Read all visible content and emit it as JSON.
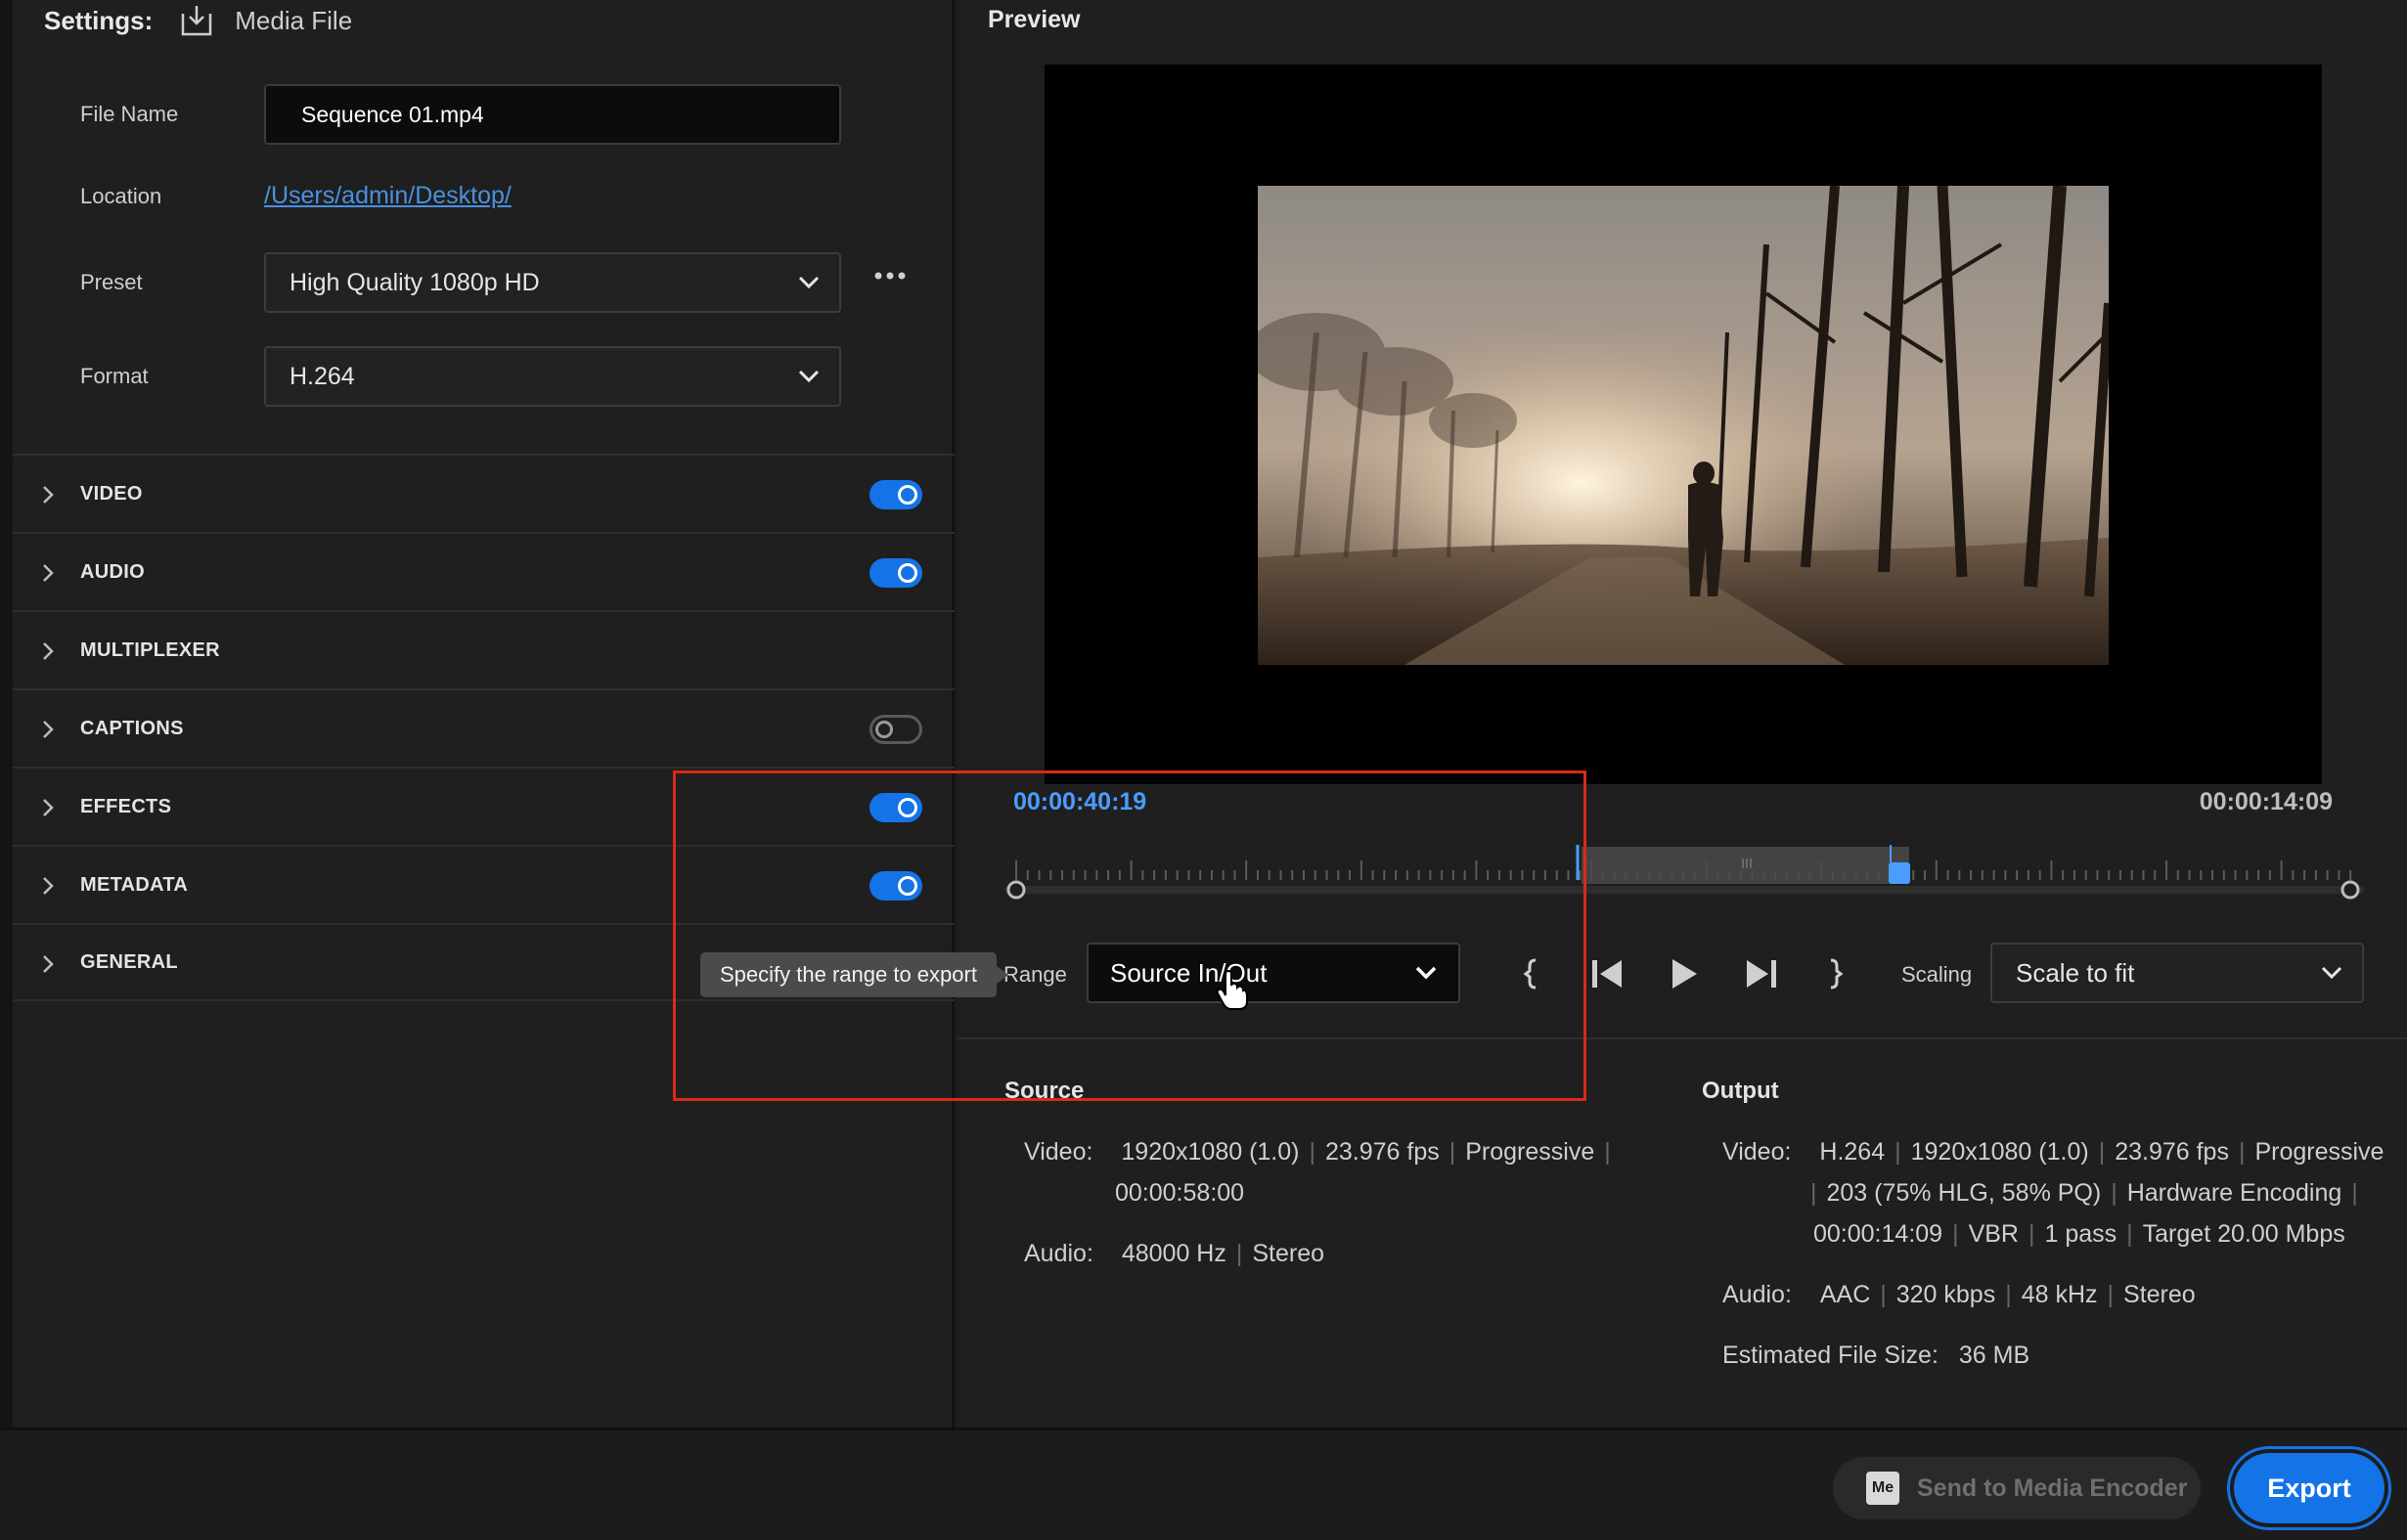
{
  "settings": {
    "title": "Settings:",
    "destination": "Media File",
    "file_name_label": "File Name",
    "file_name": "Sequence 01.mp4",
    "location_label": "Location",
    "location": "/Users/admin/Desktop/",
    "preset_label": "Preset",
    "preset": "High Quality 1080p HD",
    "format_label": "Format",
    "format": "H.264",
    "sections": [
      {
        "label": "VIDEO",
        "toggle": "on"
      },
      {
        "label": "AUDIO",
        "toggle": "on"
      },
      {
        "label": "MULTIPLEXER",
        "toggle": "none"
      },
      {
        "label": "CAPTIONS",
        "toggle": "off"
      },
      {
        "label": "EFFECTS",
        "toggle": "on"
      },
      {
        "label": "METADATA",
        "toggle": "on"
      },
      {
        "label": "GENERAL",
        "toggle": "none"
      }
    ]
  },
  "preview": {
    "title": "Preview",
    "current_time": "00:00:40:19",
    "duration": "00:00:14:09",
    "range_label": "Range",
    "range_value": "Source In/Out",
    "scaling_label": "Scaling",
    "scaling_value": "Scale to fit",
    "tooltip": "Specify the range to export"
  },
  "source": {
    "heading": "Source",
    "video_key": "Video:",
    "video_line1": [
      "1920x1080 (1.0)",
      "23.976 fps",
      "Progressive"
    ],
    "video_line2": "00:00:58:00",
    "audio_key": "Audio:",
    "audio": [
      "48000 Hz",
      "Stereo"
    ]
  },
  "output": {
    "heading": "Output",
    "video_key": "Video:",
    "video_line1": [
      "H.264",
      "1920x1080 (1.0)",
      "23.976 fps",
      "Progressive"
    ],
    "video_line2": [
      "203 (75% HLG, 58% PQ)",
      "Hardware Encoding"
    ],
    "video_line3": [
      "00:00:14:09",
      "VBR",
      "1 pass",
      "Target 20.00 Mbps"
    ],
    "audio_key": "Audio:",
    "audio": [
      "AAC",
      "320 kbps",
      "48 kHz",
      "Stereo"
    ],
    "size_label": "Estimated File Size:",
    "size": "36 MB"
  },
  "footer": {
    "me_badge": "Me",
    "send_label": "Send to Media Encoder",
    "export_label": "Export"
  },
  "colors": {
    "accent": "#1473e6",
    "timecode": "#4a9dff",
    "highlight": "#d82a1a"
  }
}
